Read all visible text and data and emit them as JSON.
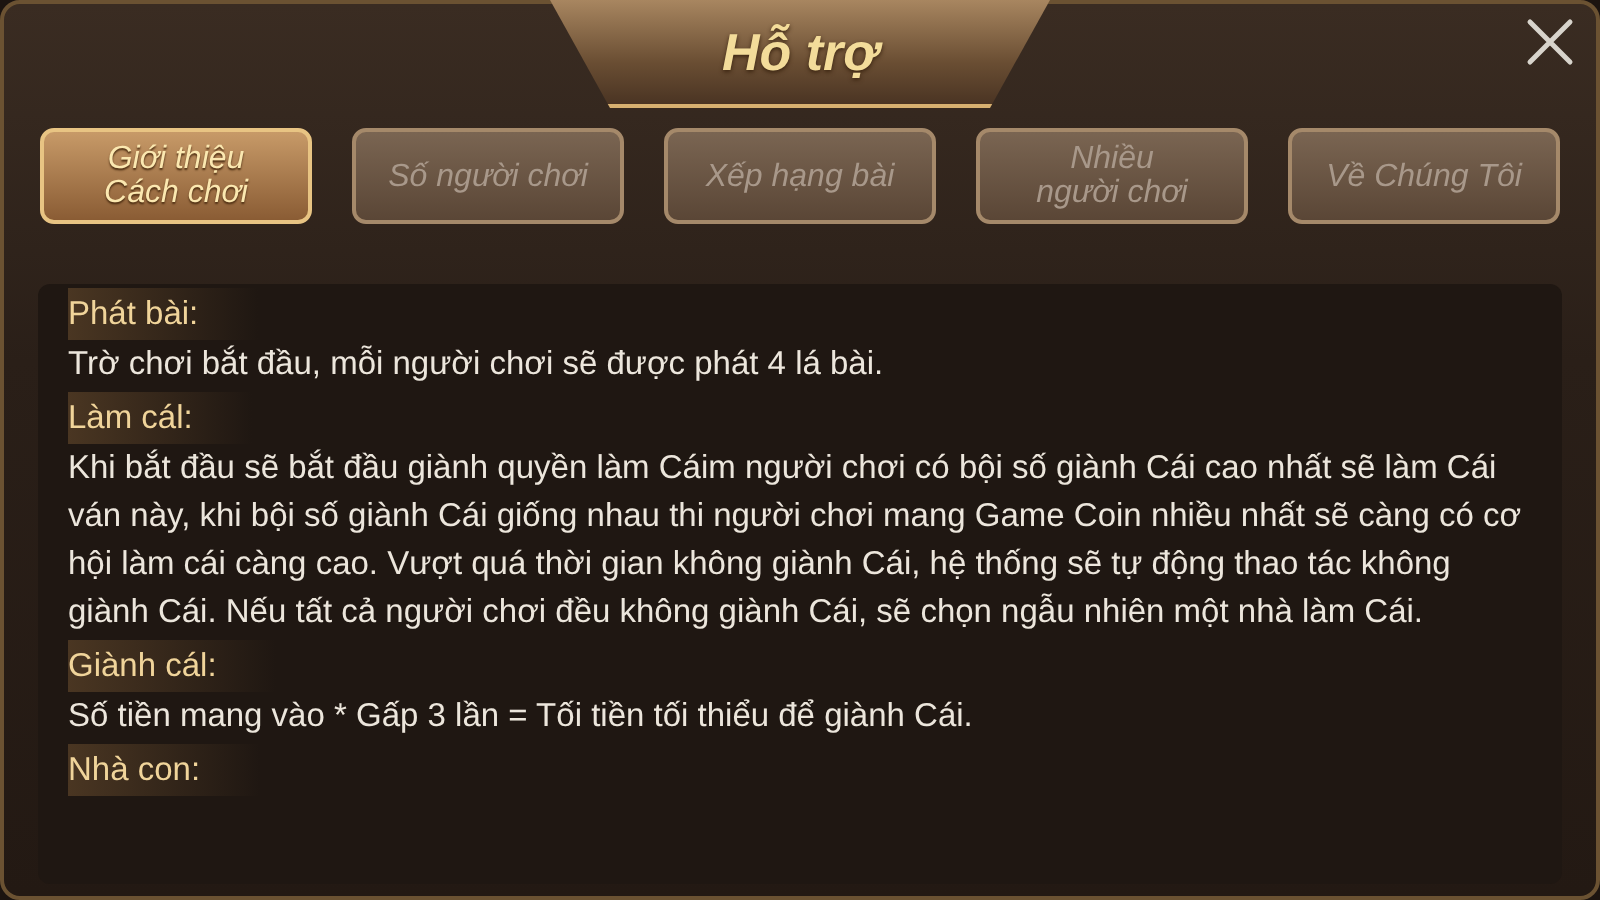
{
  "dialog": {
    "title": "Hỗ trợ"
  },
  "tabs": [
    {
      "label": "Giới thiệu\nCách chơi",
      "selected": true
    },
    {
      "label": "Số người chơi",
      "selected": false
    },
    {
      "label": "Xếp hạng bài",
      "selected": false
    },
    {
      "label": "Nhiều\nngười chơi",
      "selected": false
    },
    {
      "label": "Về Chúng Tôi",
      "selected": false
    }
  ],
  "sections": [
    {
      "heading": "Phát bài:",
      "text": "Trờ chơi bắt đầu, mỗi người chơi sẽ được phát 4 lá bài."
    },
    {
      "heading": "Làm cál:",
      "text": "Khi bắt đầu sẽ bắt đầu giành quyền làm Cáim người chơi có bội số giành Cái cao nhất sẽ làm Cái ván này, khi bội số giành Cái giống nhau thi người chơi mang Game Coin nhiều nhất sẽ càng có cơ hội làm cái càng cao. Vượt quá thời gian không giành Cái, hệ thống sẽ tự động thao tác không giành Cái. Nếu tất cả người chơi đều không giành Cái, sẽ chọn ngẫu nhiên một nhà làm Cái."
    },
    {
      "heading": "Giành cál:",
      "text": "Số tiền mang vào * Gấp 3 lần = Tối tiền tối thiểu để giành Cái."
    },
    {
      "heading": "Nhà con:"
    }
  ]
}
